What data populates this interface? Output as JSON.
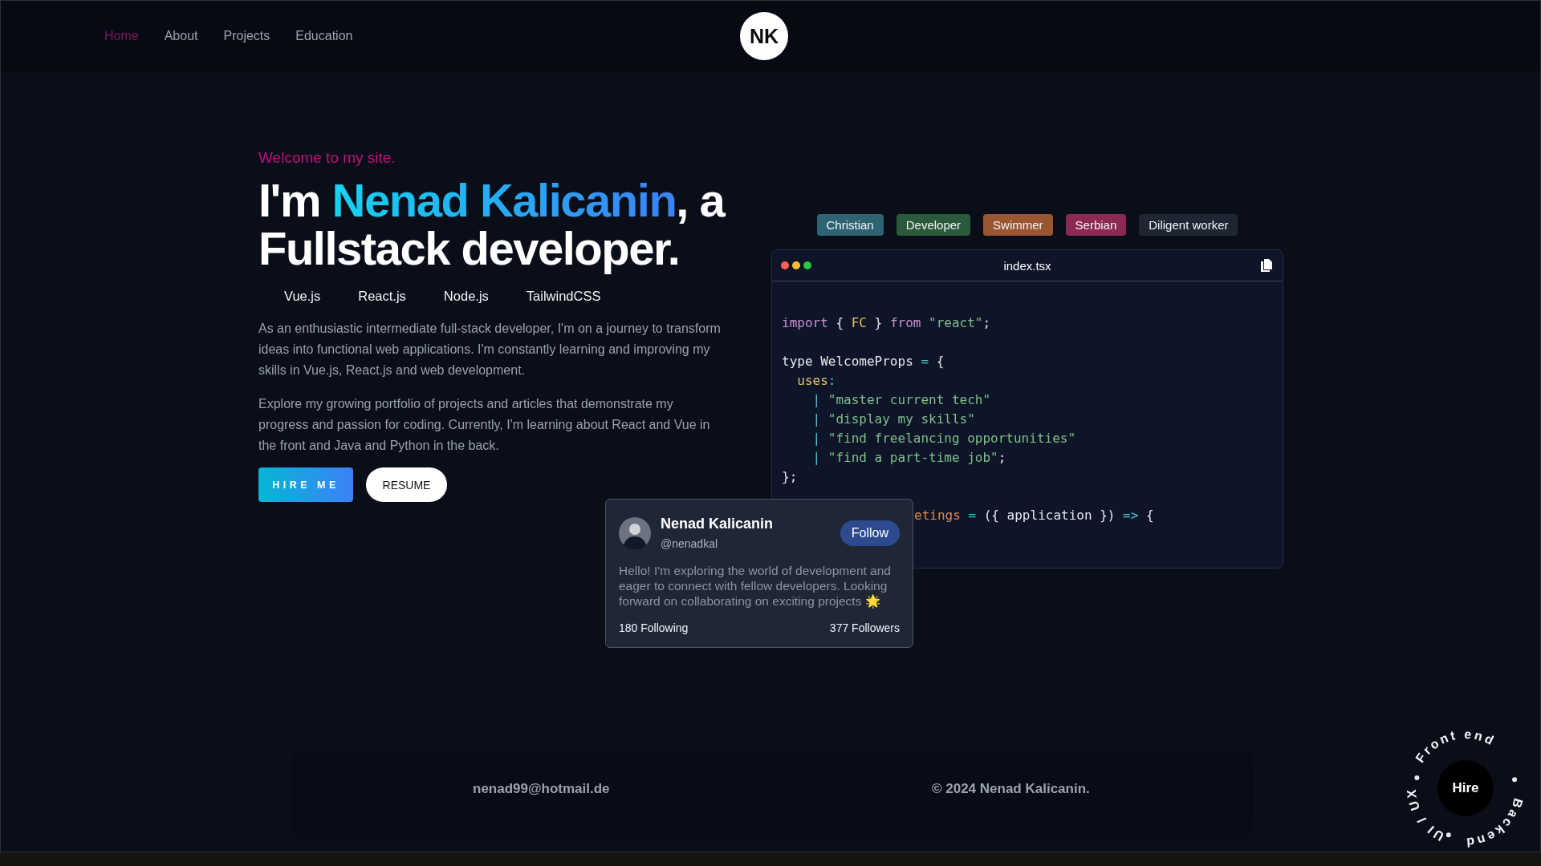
{
  "nav": {
    "links": [
      {
        "label": "Home",
        "selected": true
      },
      {
        "label": "About",
        "selected": false
      },
      {
        "label": "Projects",
        "selected": false
      },
      {
        "label": "Education",
        "selected": false
      }
    ],
    "logo": "NK"
  },
  "hero": {
    "welcome": "Welcome to my site.",
    "headline": {
      "before": "I'm ",
      "highlight": "Nenad Kalicanin",
      "after": ", a Fullstack developer."
    },
    "tech": [
      "Vue.js",
      "React.js",
      "Node.js",
      "TailwindCSS"
    ],
    "paragraphs": [
      "As an enthusiastic intermediate full-stack developer, I'm on a journey to transform ideas into functional web applications. I'm constantly learning and improving my skills in Vue.js, React.js and web development.",
      "Explore my growing portfolio of projects and articles that demonstrate my progress and passion for coding. Currently, I'm learning about React and Vue in the front and Java and Python in the back."
    ],
    "buttons": [
      {
        "kind": "primary",
        "label": "HIRE ME"
      },
      {
        "kind": "secondary",
        "label": "RESUME"
      }
    ]
  },
  "tags": [
    {
      "label": "Christian",
      "color": "#2e6372"
    },
    {
      "label": "Developer",
      "color": "#2a5a3b"
    },
    {
      "label": "Swimmer",
      "color": "#9a5630"
    },
    {
      "label": "Serbian",
      "color": "#8c2a55"
    },
    {
      "label": "Diligent worker",
      "color": "#1f2633"
    }
  ],
  "code_window": {
    "filename": "index.tsx",
    "lines": [
      {
        "kind": "code",
        "tokens": [
          {
            "kind": "keyword",
            "text": "import"
          },
          {
            "kind": "plain",
            "text": " { "
          },
          {
            "kind": "type",
            "text": "FC"
          },
          {
            "kind": "plain",
            "text": " } "
          },
          {
            "kind": "keyword",
            "text": "from"
          },
          {
            "kind": "string",
            "text": " \"react\""
          },
          {
            "kind": "plain",
            "text": ";"
          }
        ]
      },
      {
        "kind": "blank"
      },
      {
        "kind": "code",
        "tokens": [
          {
            "kind": "plain",
            "text": "type WelcomeProps "
          },
          {
            "kind": "op",
            "text": "="
          },
          {
            "kind": "plain",
            "text": " {"
          }
        ]
      },
      {
        "kind": "code",
        "tokens": [
          {
            "kind": "type",
            "text": "  uses"
          },
          {
            "kind": "op",
            "text": ":"
          }
        ]
      },
      {
        "kind": "code",
        "tokens": [
          {
            "kind": "op",
            "text": "    | "
          },
          {
            "kind": "string",
            "text": "\"master current tech\""
          }
        ]
      },
      {
        "kind": "code",
        "tokens": [
          {
            "kind": "op",
            "text": "    | "
          },
          {
            "kind": "string",
            "text": "\"display my skills\""
          }
        ]
      },
      {
        "kind": "code",
        "tokens": [
          {
            "kind": "op",
            "text": "    | "
          },
          {
            "kind": "string",
            "text": "\"find freelancing opportunities\""
          }
        ]
      },
      {
        "kind": "code",
        "tokens": [
          {
            "kind": "op",
            "text": "    | "
          },
          {
            "kind": "string",
            "text": "\"find a part-time job\""
          },
          {
            "kind": "plain",
            "text": ";"
          }
        ]
      },
      {
        "kind": "code",
        "tokens": [
          {
            "kind": "plain",
            "text": "};"
          }
        ]
      },
      {
        "kind": "blank"
      },
      {
        "kind": "covered",
        "tokens": [
          {
            "kind": "func",
            "text": "etings"
          },
          {
            "kind": "op",
            "text": " ="
          },
          {
            "kind": "plain",
            "text": " ({ application }) "
          },
          {
            "kind": "op",
            "text": "=>"
          },
          {
            "kind": "plain",
            "text": " {"
          }
        ]
      }
    ]
  },
  "profile_card": {
    "name": "Nenad Kalicanin",
    "handle": "@nenadkal",
    "follow": "Follow",
    "bio": "Hello! I'm exploring the world of development and eager to connect with fellow developers. Looking forward on collaborating on exciting projects 🌟",
    "following": "180 Following",
    "followers": "377 Followers"
  },
  "footer": {
    "email": "nenad99@hotmail.de",
    "copyright": "© 2024 Nenad Kalicanin."
  },
  "hire_badge": {
    "button": "Hire",
    "ring": [
      "Front end",
      "Backend",
      "UI / UX"
    ]
  }
}
